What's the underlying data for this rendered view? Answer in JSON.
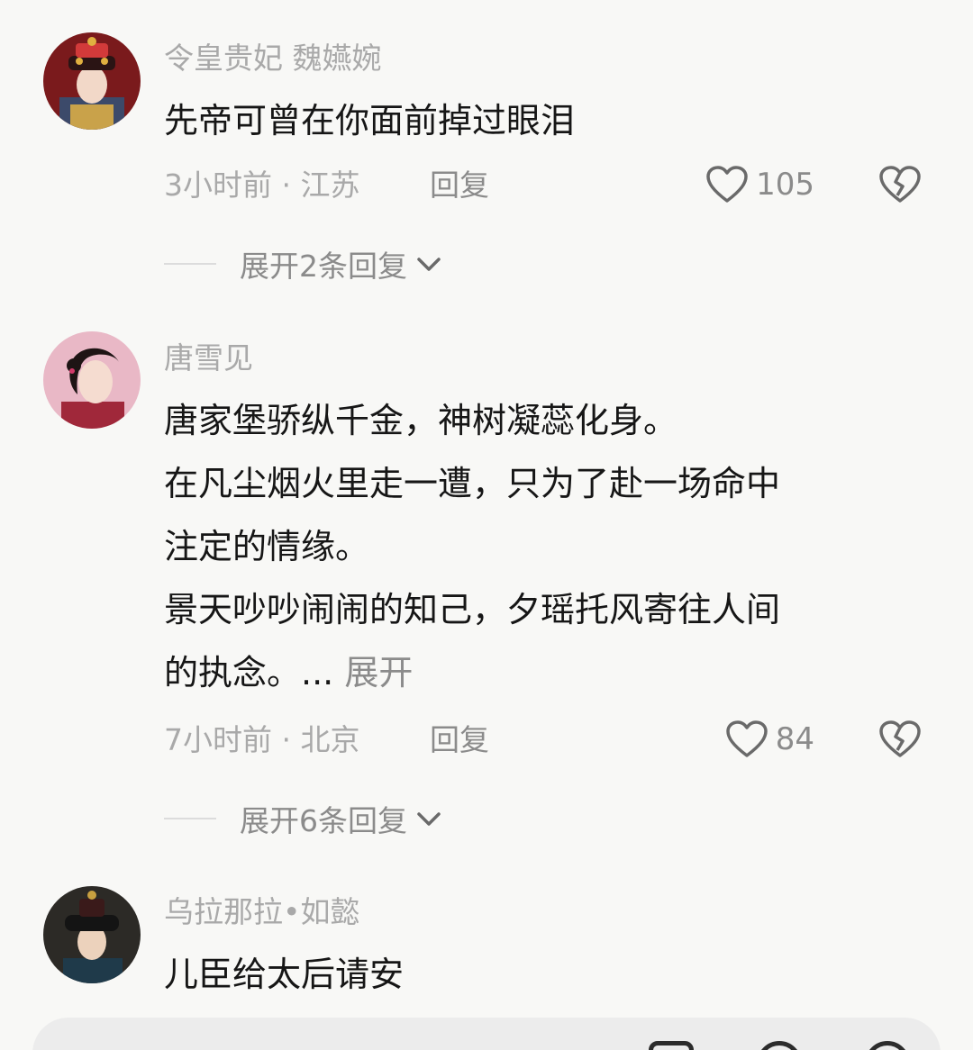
{
  "comments": [
    {
      "username": "令皇贵妃 魏嬿婉",
      "lines": [
        "先帝可曾在你面前掉过眼泪"
      ],
      "time_location": "3小时前 · 江苏",
      "reply_label": "回复",
      "likes": "105",
      "expand_replies": "展开2条回复"
    },
    {
      "username": "唐雪见",
      "lines": [
        "唐家堡骄纵千金，神树凝蕊化身。",
        "在凡尘烟火里走一遭，只为了赴一场命中",
        "注定的情缘。",
        "景天吵吵闹闹的知己，夕瑶托风寄往人间",
        "的执念。..."
      ],
      "expand_text": " 展开",
      "time_location": "7小时前 · 北京",
      "reply_label": "回复",
      "likes": "84",
      "expand_replies": "展开6条回复"
    },
    {
      "username": "乌拉那拉•如懿",
      "lines": [
        "儿臣给太后请安"
      ]
    }
  ],
  "icons": {
    "like": "heart-outline-icon",
    "dislike": "broken-heart-icon",
    "expand": "chevron-down-icon"
  },
  "colors": {
    "background": "#f8f8f6",
    "text_primary": "#161616",
    "text_secondary": "#a9a9a9",
    "text_action": "#8b8b8b"
  }
}
